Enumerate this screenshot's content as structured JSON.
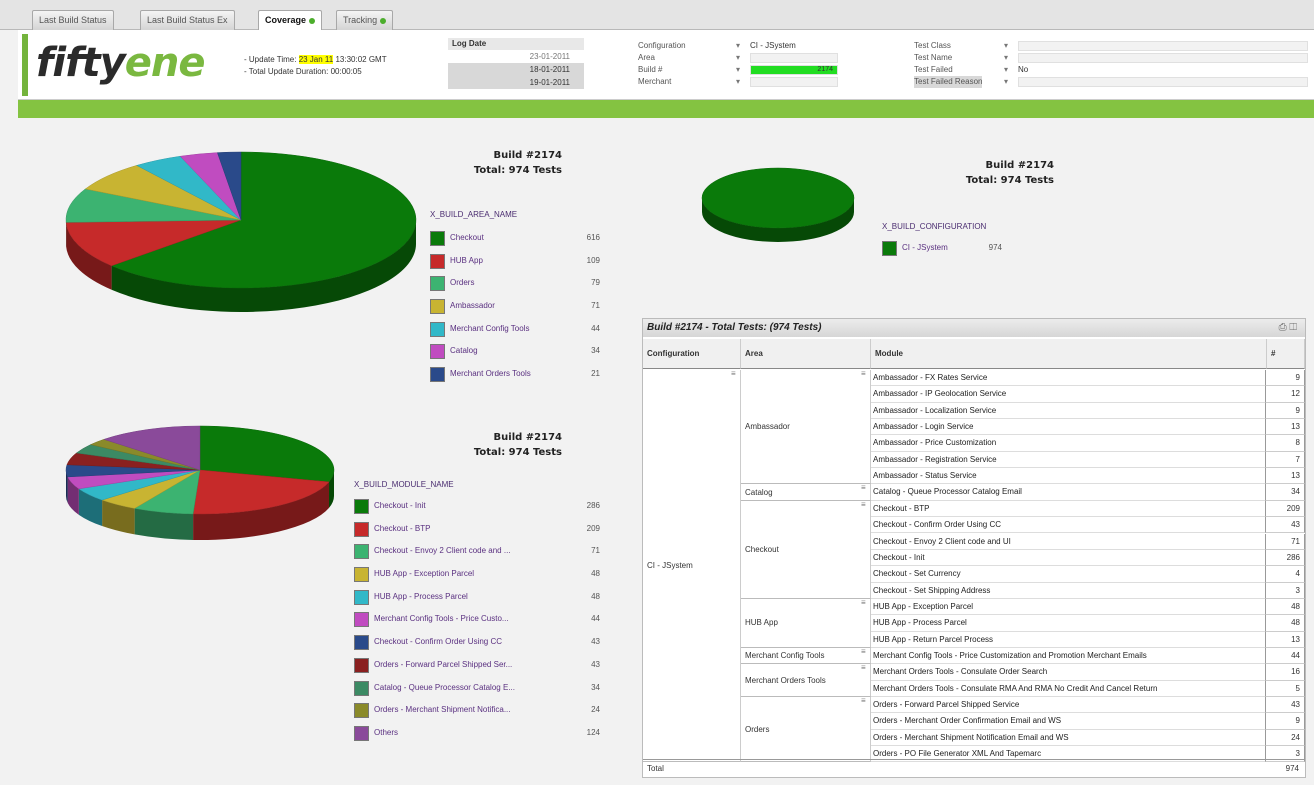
{
  "tabs": [
    {
      "label": "Last Build Status",
      "active": false,
      "dot": false
    },
    {
      "label": "Last Build Status Ex",
      "active": false,
      "dot": false
    },
    {
      "label": "Coverage",
      "active": true,
      "dot": true
    },
    {
      "label": "Tracking",
      "active": false,
      "dot": true
    }
  ],
  "header": {
    "logo_a": "fifty",
    "logo_b": "e",
    "logo_c": "ne",
    "update_prefix": "- Update Time: ",
    "update_time": "23 Jan 11",
    "update_suffix": " 13:30:02 GMT",
    "duration": "- Total Update Duration: 00:00:05",
    "logdate_label": "Log Date",
    "logdates": [
      "23-01-2011",
      "18-01-2011",
      "19-01-2011"
    ],
    "filters_mid": [
      {
        "label": "Configuration",
        "value": "CI - JSystem"
      },
      {
        "label": "Area",
        "value": ""
      },
      {
        "label": "Build #",
        "value": "2174"
      },
      {
        "label": "Merchant",
        "value": ""
      }
    ],
    "filters_right": [
      {
        "label": "Test Class",
        "value": ""
      },
      {
        "label": "Test Name",
        "value": ""
      },
      {
        "label": "Test Failed",
        "value": "No"
      },
      {
        "label": "Test Failed Reason",
        "value": ""
      }
    ]
  },
  "chart_data": [
    {
      "type": "pie",
      "title": "Build #2174",
      "subtitle": "Total: 974 Tests",
      "legend_title": "X_BUILD_AREA_NAME",
      "categories": [
        "Checkout",
        "HUB App",
        "Orders",
        "Ambassador",
        "Merchant Config Tools",
        "Catalog",
        "Merchant Orders Tools"
      ],
      "values": [
        616,
        109,
        79,
        71,
        44,
        34,
        21
      ],
      "colors": [
        "#0a7a0a",
        "#c62a2a",
        "#3cb371",
        "#c8b432",
        "#31b8c8",
        "#c04cc0",
        "#2a4a8a"
      ]
    },
    {
      "type": "pie",
      "title": "Build #2174",
      "subtitle": "Total: 974 Tests",
      "legend_title": "X_BUILD_CONFIGURATION",
      "categories": [
        "CI - JSystem"
      ],
      "values": [
        974
      ],
      "colors": [
        "#0a7a0a"
      ]
    },
    {
      "type": "pie",
      "title": "Build #2174",
      "subtitle": "Total: 974 Tests",
      "legend_title": "X_BUILD_MODULE_NAME",
      "categories": [
        "Checkout - Init",
        "Checkout - BTP",
        "Checkout - Envoy 2 Client code and ...",
        "HUB App - Exception Parcel",
        "HUB App - Process Parcel",
        "Merchant Config Tools - Price Custo...",
        "Checkout - Confirm Order Using CC",
        "Orders - Forward Parcel Shipped Ser...",
        "Catalog - Queue Processor Catalog E...",
        "Orders - Merchant Shipment Notifica...",
        "Others"
      ],
      "values": [
        286,
        209,
        71,
        48,
        48,
        44,
        43,
        43,
        34,
        24,
        124
      ],
      "colors": [
        "#0a7a0a",
        "#c62a2a",
        "#3cb371",
        "#c8b432",
        "#31b8c8",
        "#c04cc0",
        "#2a4a8a",
        "#8a2020",
        "#3c8a64",
        "#8a8a2a",
        "#8a4a9a"
      ]
    },
    {
      "type": "table",
      "title": "Build #2174 - Total Tests: (974 Tests)",
      "columns": [
        "Configuration",
        "Area",
        "Module",
        "#"
      ],
      "configuration": "CI - JSystem",
      "groups": [
        {
          "area": "Ambassador",
          "rows": [
            {
              "module": "Ambassador - FX Rates Service",
              "count": 9
            },
            {
              "module": "Ambassador - IP Geolocation Service",
              "count": 12
            },
            {
              "module": "Ambassador - Localization Service",
              "count": 9
            },
            {
              "module": "Ambassador - Login Service",
              "count": 13
            },
            {
              "module": "Ambassador - Price Customization",
              "count": 8
            },
            {
              "module": "Ambassador - Registration Service",
              "count": 7
            },
            {
              "module": "Ambassador - Status Service",
              "count": 13
            }
          ]
        },
        {
          "area": "Catalog",
          "rows": [
            {
              "module": "Catalog - Queue Processor Catalog Email",
              "count": 34
            }
          ]
        },
        {
          "area": "Checkout",
          "rows": [
            {
              "module": "Checkout - BTP",
              "count": 209
            },
            {
              "module": "Checkout - Confirm Order Using CC",
              "count": 43
            },
            {
              "module": "Checkout - Envoy 2 Client code and UI",
              "count": 71
            },
            {
              "module": "Checkout - Init",
              "count": 286
            },
            {
              "module": "Checkout - Set Currency",
              "count": 4
            },
            {
              "module": "Checkout - Set Shipping Address",
              "count": 3
            }
          ]
        },
        {
          "area": "HUB App",
          "rows": [
            {
              "module": "HUB App - Exception Parcel",
              "count": 48
            },
            {
              "module": "HUB App - Process Parcel",
              "count": 48
            },
            {
              "module": "HUB App - Return Parcel Process",
              "count": 13
            }
          ]
        },
        {
          "area": "Merchant Config Tools",
          "rows": [
            {
              "module": "Merchant Config Tools - Price Customization and Promotion Merchant Emails",
              "count": 44
            }
          ]
        },
        {
          "area": "Merchant Orders Tools",
          "rows": [
            {
              "module": "Merchant Orders Tools - Consulate Order Search",
              "count": 16
            },
            {
              "module": "Merchant Orders Tools - Consulate RMA And RMA No Credit And Cancel Return",
              "count": 5
            }
          ]
        },
        {
          "area": "Orders",
          "rows": [
            {
              "module": "Orders - Forward Parcel Shipped Service",
              "count": 43
            },
            {
              "module": "Orders - Merchant Order Confirmation Email and WS",
              "count": 9
            },
            {
              "module": "Orders - Merchant Shipment Notification Email and WS",
              "count": 24
            },
            {
              "module": "Orders - PO File Generator XML And Tapemarc",
              "count": 3
            }
          ]
        }
      ],
      "total_label": "Total",
      "total": 974
    }
  ]
}
